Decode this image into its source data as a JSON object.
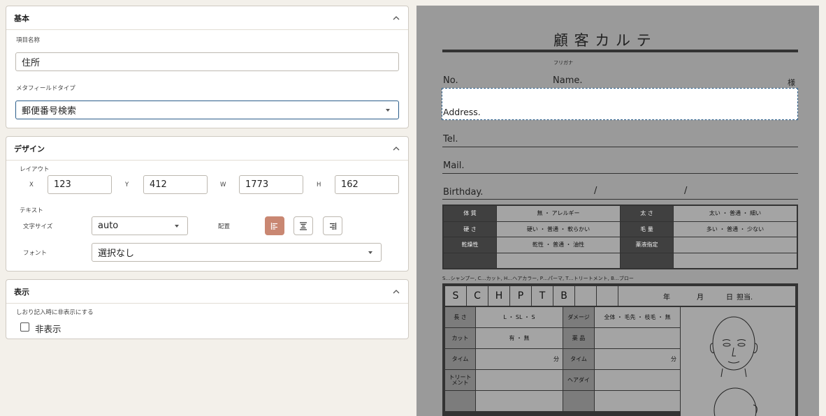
{
  "sections": {
    "basic": {
      "title": "基本",
      "item_name_label": "項目名称",
      "item_name_value": "住所",
      "meta_type_label": "メタフィールドタイプ",
      "meta_type_value": "郵便番号検索"
    },
    "design": {
      "title": "デザイン",
      "layout_label": "レイアウト",
      "x_label": "X",
      "x_value": "123",
      "y_label": "Y",
      "y_value": "412",
      "w_label": "W",
      "w_value": "1773",
      "h_label": "H",
      "h_value": "162",
      "text_label": "テキスト",
      "font_size_label": "文字サイズ",
      "font_size_value": "auto",
      "align_label": "配置",
      "font_label": "フォント",
      "font_value": "選択なし"
    },
    "display": {
      "title": "表示",
      "hide_desc": "しおり記入時に非表示にする",
      "hide_checkbox_label": "非表示"
    }
  },
  "preview": {
    "title": "顧 客 カ ル テ",
    "furigana": "フリガナ",
    "no": "No.",
    "name": "Name.",
    "sama": "様",
    "address": "Address.",
    "tel": "Tel.",
    "mail": "Mail.",
    "birthday": "Birthday.",
    "slash": "/",
    "grid1": [
      [
        "体 質",
        "無 ・ アレルギー",
        "太 さ",
        "太い ・ 普通 ・ 細い"
      ],
      [
        "硬 さ",
        "硬い ・ 普通 ・ 軟らかい",
        "毛 量",
        "多い ・ 普通 ・ 少ない"
      ],
      [
        "乾燥性",
        "乾性 ・ 普通 ・ 油性",
        "薬液指定",
        ""
      ],
      [
        "",
        "",
        "",
        ""
      ]
    ],
    "legend": "S…シャンプー, C…カット, H…ヘアカラー, P…パーマ, T…トリートメント, B…ブロー",
    "service_letters": [
      "S",
      "C",
      "H",
      "P",
      "T",
      "B"
    ],
    "date_year": "年",
    "date_month": "月",
    "date_day": "日",
    "staff": "担当.",
    "rows": [
      {
        "l1": "長 さ",
        "v1": "L ・ SL ・ S",
        "l2": "ダメージ",
        "v2": "全体 ・ 毛先 ・ 枝毛 ・ 無"
      },
      {
        "l1": "カット",
        "v1": "有 ・ 無",
        "l2": "薬 品",
        "v2": ""
      },
      {
        "l1": "タイム",
        "v1": "分",
        "l2": "タイム",
        "v2": "分"
      },
      {
        "l1": "トリート\nメント",
        "v1": "",
        "l2": "ヘアダイ",
        "v2": ""
      },
      {
        "l1": "",
        "v1": "",
        "l2": "",
        "v2": ""
      }
    ]
  },
  "colors": {
    "accent": "#c98772",
    "focus": "#2a5d8a",
    "preview_bg": "#9a9a9a"
  }
}
